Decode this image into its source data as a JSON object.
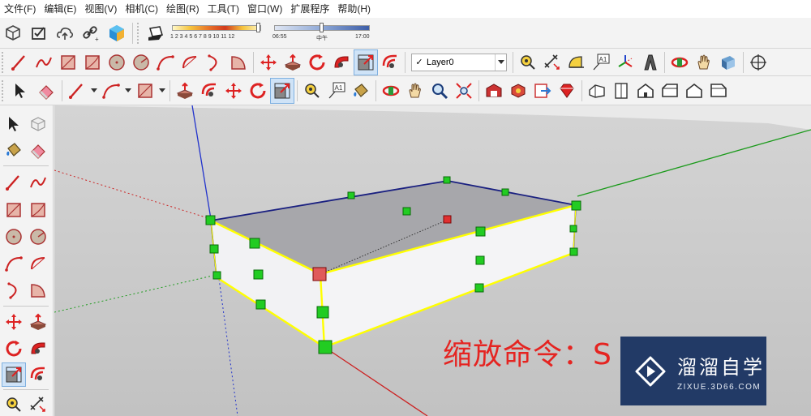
{
  "menu": [
    {
      "label": "文件(F)"
    },
    {
      "label": "编辑(E)"
    },
    {
      "label": "视图(V)"
    },
    {
      "label": "相机(C)"
    },
    {
      "label": "绘图(R)"
    },
    {
      "label": "工具(T)"
    },
    {
      "label": "窗口(W)"
    },
    {
      "label": "扩展程序"
    },
    {
      "label": "帮助(H)"
    }
  ],
  "shadow": {
    "month_ticks": "1 2 3 4 5 6 7 8 9 10 11 12",
    "time_start": "06:55",
    "time_mid": "中午",
    "time_end": "17:00"
  },
  "layer": {
    "current": "Layer0"
  },
  "text_tool_label": "A1",
  "caption": "缩放命令：S",
  "watermark": {
    "name": "溜溜自学",
    "url": "ZIXUE.3D66.COM"
  },
  "colors": {
    "caption": "#e52421",
    "selection": "#ffff00",
    "grip": "#22cc22",
    "center_grip": "#e03030",
    "top_face": "#a7a7ab",
    "side_face": "#f2f2f4",
    "ground": "#c4c4c4",
    "sky": "#f6f6f6",
    "watermark_bg": "#223a66"
  }
}
